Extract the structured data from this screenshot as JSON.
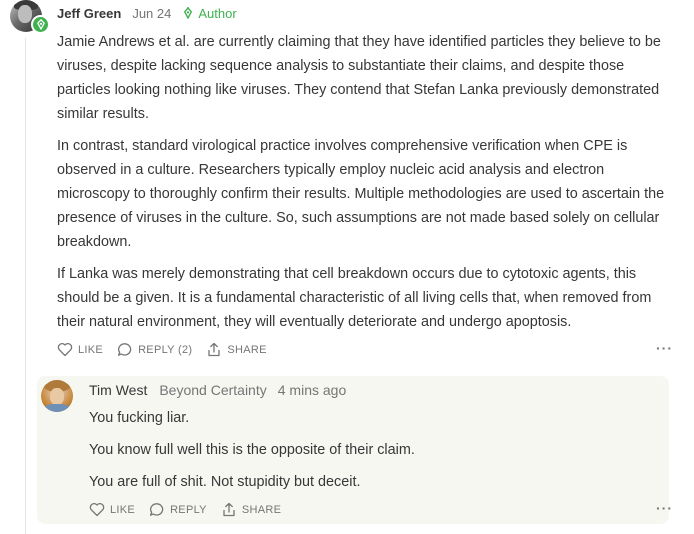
{
  "main_comment": {
    "author": "Jeff Green",
    "date": "Jun 24",
    "badge_label": "Author",
    "paragraphs": [
      "Jamie Andrews et al. are currently claiming that they have identified particles they believe to be viruses, despite lacking sequence analysis to substantiate their claims, and despite those particles looking nothing like viruses. They contend that Stefan Lanka previously demonstrated similar results.",
      "In contrast, standard virological practice involves comprehensive verification when CPE is observed in a culture. Researchers typically employ nucleic acid analysis and electron microscopy to thoroughly confirm their results. Multiple methodologies are used to ascertain the presence of viruses in the culture. So, such assumptions are not made based solely on cellular breakdown.",
      "If Lanka was merely demonstrating that cell breakdown occurs due to cytotoxic agents, this should be a given. It is a fundamental characteristic of all living cells that, when removed from their natural environment, they will eventually deteriorate and undergo apoptosis."
    ],
    "actions": {
      "like": "LIKE",
      "reply": "REPLY (2)",
      "share": "SHARE"
    },
    "more_label": "···"
  },
  "reply_comment": {
    "author": "Tim West",
    "subtitle": "Beyond Certainty",
    "time": "4 mins ago",
    "paragraphs": [
      "You fucking liar.",
      "You know full well this is the opposite of their claim.",
      "You are full of shit. Not stupidity but deceit."
    ],
    "actions": {
      "like": "LIKE",
      "reply": "REPLY",
      "share": "SHARE"
    },
    "more_label": "···"
  },
  "colors": {
    "author_green": "#3fb24f",
    "reply_background": "#f7f7f2",
    "text": "#363737",
    "muted": "#757575"
  },
  "icons": [
    "author-pen-icon",
    "heart-icon",
    "comment-icon",
    "share-icon",
    "more-icon"
  ]
}
